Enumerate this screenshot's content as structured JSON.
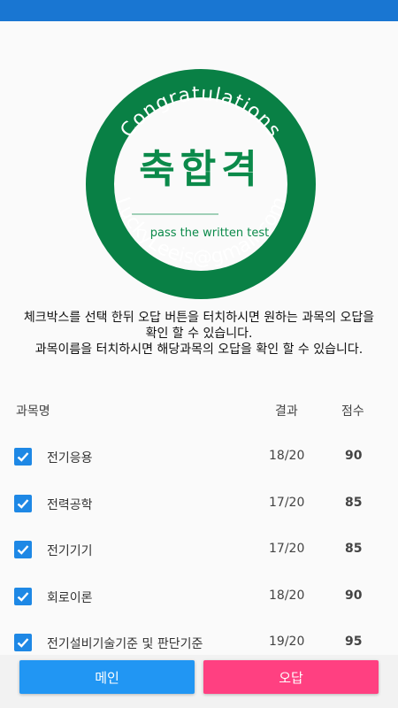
{
  "stamp": {
    "top_text": "Congratulations",
    "title": "축합격",
    "subtitle": "pass the written test",
    "bottom_text": "LuckyLeeis@gmail.com",
    "ring_color": "#098045",
    "title_color": "#0b8a4a"
  },
  "instructions": {
    "line1": "체크박스를 선택 한뒤 오답 버튼을 터치하시면 원하는 과목의 오답을 확인 할 수 있습니다.",
    "line2": "과목이름을 터치하시면 해당과목의 오답을 확인 할 수 있습니다."
  },
  "table": {
    "headers": {
      "name": "과목명",
      "result": "결과",
      "score": "점수"
    },
    "rows": [
      {
        "name": "전기응용",
        "result": "18/20",
        "score": "90",
        "checked": true
      },
      {
        "name": "전력공학",
        "result": "17/20",
        "score": "85",
        "checked": true
      },
      {
        "name": "전기기기",
        "result": "17/20",
        "score": "85",
        "checked": true
      },
      {
        "name": "회로이론",
        "result": "18/20",
        "score": "90",
        "checked": true
      },
      {
        "name": "전기설비기술기준 및 판단기준",
        "result": "19/20",
        "score": "95",
        "checked": true
      }
    ]
  },
  "buttons": {
    "main": "메인",
    "wrong": "오답"
  },
  "colors": {
    "status_bar": "#1976d2",
    "checkbox": "#1e88e5",
    "main_button": "#2196f3",
    "wrong_button": "#ff4081"
  }
}
